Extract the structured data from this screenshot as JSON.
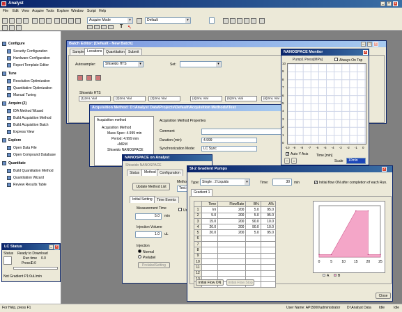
{
  "app": {
    "title": "Analyst"
  },
  "menu": [
    "File",
    "Edit",
    "View",
    "Acquire",
    "Tools",
    "Explore",
    "Window",
    "Script",
    "Help"
  ],
  "toolbar": {
    "mode": "Acquire Mode",
    "project": "Default"
  },
  "nav": {
    "configure": "Configure",
    "security": "Security Configuration",
    "hardware": "Hardware Configuration",
    "report": "Report Template Editor",
    "tune": "Tune",
    "resolution": "Resolution Optimization",
    "quantitative": "Quantitative Optimization",
    "manual": "Manual Tuning",
    "acquire": "Acquire",
    "acquire_count": "(2)",
    "ida": "IDA Method Wizard",
    "build_method": "Build Acquisition Method",
    "build_batch": "Build Acquisition Batch",
    "express": "Express View",
    "explore": "Explore",
    "open_data": "Open Data File",
    "open_compound": "Open Compound Database",
    "quantitate": "Quantitate",
    "build_quant": "Build Quantitation Method",
    "quant_wizard": "Quantitation Wizard",
    "review": "Review Results Table"
  },
  "lc_status": {
    "title": "LC Status",
    "status_label": "Status",
    "status": "Ready to Download",
    "run_label": "Run time",
    "run_time": "0.0",
    "press_label": "Press1",
    "press": "0.0",
    "footer": "Not Gradient P1:0uL/min"
  },
  "status_bar": {
    "help": "For Help, press F1",
    "user": "User Name: API3000\\administrator",
    "data": "D:\\Analyst Data",
    "idle1": "Idle",
    "idle2": "Idle"
  },
  "batch": {
    "title": "Batch Editor: [Default - New Batch]",
    "tabs": [
      "Sample",
      "Locations",
      "Quantitation",
      "Submit"
    ],
    "autosampler_label": "Autosampler:",
    "autosampler": "Shiseido HTS",
    "set_label": "Set:",
    "tray": "Shiseido HTS",
    "vials": [
      "(1)2mL Vial",
      "(2)2mL Vial",
      "(3)2mL Vial",
      "(4)2mL Vial",
      "(5)2mL Vial",
      "(6)2mL Vial"
    ]
  },
  "acq": {
    "title": "Acquisition Method: D:\\Analyst Data\\Projects\\Default\\Acquisition Methods\\Test",
    "tree_header": "Acquisition method",
    "tree": [
      "Acquisition Method",
      "Mass Spec: 4.999 min",
      "Period: 4.999 min",
      "+MRM",
      "Shiseido NANOSPACE"
    ],
    "props_header": "Acquisition Method Properties",
    "comment_label": "Comment",
    "duration_label": "Duration (min)",
    "duration": "4.999",
    "sync_label": "Synchronization Mode:",
    "sync": "LC Sync"
  },
  "nano_analyst": {
    "title": "NANOSPACE on Analyst",
    "subtitle": "Shiseido NANOSPACE",
    "tabs": [
      "Status",
      "Method",
      "Configuration"
    ],
    "update_btn": "Update Method List",
    "method_label": "Method N",
    "method": "Test.de",
    "subtabs": [
      "Initial Setting",
      "Time Events"
    ],
    "meas_label": "Measurement Time",
    "meas": "5.0",
    "min": "min",
    "inj_vol_label": "Injection Volume",
    "inj_vol": "1.0",
    "ul": "uL",
    "injection_label": "Injection",
    "normal": "Normal",
    "prelabel": "Prelabel",
    "prelabel_btn": "PrelabelSetting",
    "use_label": "Use"
  },
  "monitor": {
    "title": "NANOSPACE Monitor",
    "legend": "Pump1 Press[MPa]",
    "always_on_top": "Always On Top",
    "auto_y": "Auto Y Axis",
    "xaxis": "Time [min]",
    "scale_label": "Scale",
    "scale": "10min",
    "yticks": [
      "10",
      "9",
      "8",
      "7",
      "6",
      "5",
      "4",
      "3",
      "2",
      "1",
      "0"
    ],
    "xticks": [
      "-10",
      "-9",
      "-8",
      "-7",
      "-6",
      "-5",
      "-4",
      "-3",
      "-2",
      "-1",
      "0"
    ]
  },
  "si2": {
    "title": "SI-2 Gradient Pumps",
    "type_label": "Type:",
    "type": "Single : 2 Liquids",
    "time_label": "Time:",
    "time": "30",
    "min": "min",
    "initial_flow_label": "Initial flow ON after completion of each Run.",
    "tab": "Gradient 1",
    "columns": [
      "",
      "Time",
      "FlowRate",
      "B%",
      "A%"
    ],
    "rows": [
      [
        "1",
        "Ini",
        "200",
        "5.0",
        "95.0"
      ],
      [
        "2",
        "5.0",
        "200",
        "5.0",
        "95.0"
      ],
      [
        "3",
        "15.0",
        "200",
        "90.0",
        "10.0"
      ],
      [
        "4",
        "20.0",
        "200",
        "90.0",
        "10.0"
      ],
      [
        "5",
        "20.0",
        "200",
        "5.0",
        "95.0"
      ],
      [
        "6",
        "",
        "",
        "",
        ""
      ],
      [
        "7",
        "",
        "",
        "",
        ""
      ],
      [
        "8",
        "",
        "",
        "",
        ""
      ],
      [
        "9",
        "",
        "",
        "",
        ""
      ],
      [
        "10",
        "",
        "",
        "",
        ""
      ],
      [
        "11",
        "",
        "",
        "",
        ""
      ],
      [
        "12",
        "",
        "",
        "",
        ""
      ],
      [
        "13",
        "",
        "",
        "",
        ""
      ],
      [
        "14",
        "",
        "",
        "",
        ""
      ]
    ],
    "btn_on": "Initial Flow ON",
    "btn_stop": "Initial Flow Stop",
    "close": "Close",
    "legend_a": "A",
    "legend_b": "B",
    "xticks": [
      "0",
      "5",
      "10",
      "15",
      "20",
      "25"
    ]
  },
  "chart_data": {
    "type": "area",
    "x": [
      0,
      5,
      15,
      20,
      20,
      25
    ],
    "series": [
      {
        "name": "B",
        "values": [
          5,
          5,
          90,
          90,
          5,
          5
        ]
      }
    ],
    "xlim": [
      0,
      25
    ],
    "ylim": [
      0,
      100
    ],
    "legend": [
      "A",
      "B"
    ]
  }
}
